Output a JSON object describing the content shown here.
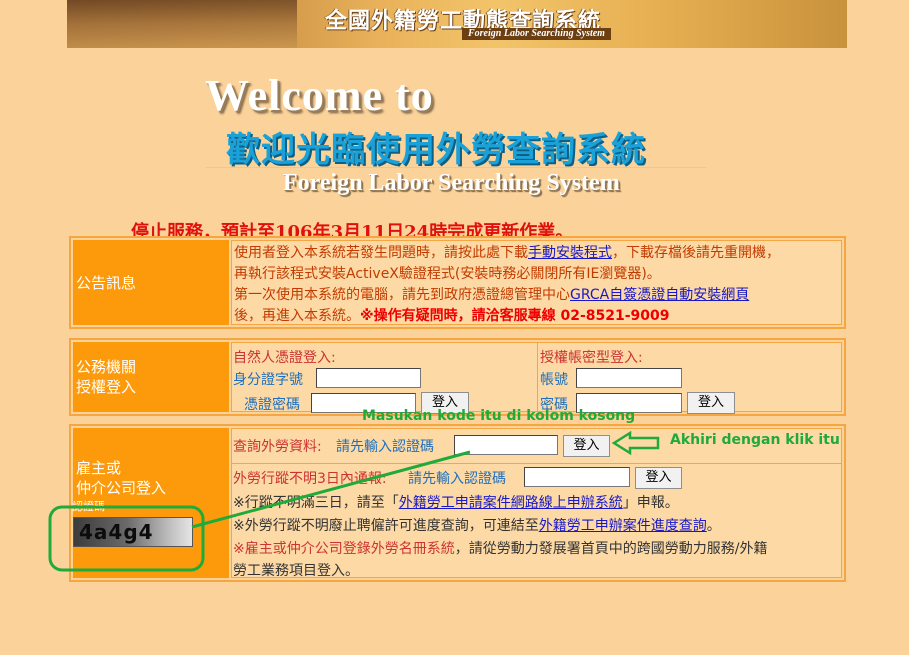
{
  "banner": {
    "title": "全國外籍勞工動態查詢系統",
    "subtitle": "Foreign Labor Searching System"
  },
  "welcome": {
    "en": "Welcome to",
    "zh": "歡迎光臨使用外勞查詢系統",
    "sub": "Foreign Labor Searching System"
  },
  "marquee": "停止服務，預計至106年3月11日24時完成更新作業。",
  "announcement": {
    "head": "公告訊息",
    "line1_pre": "使用者登入本系統若發生問題時，請按此處下載",
    "line1_link": "手動安裝程式",
    "line1_post": "，下載存檔後請先重開機，",
    "line2": "再執行該程式安裝ActiveX驗證程式(安裝時務必關閉所有IE瀏覽器)。",
    "line3_pre": "第一次使用本系統的電腦，請先到政府憑證總管理中心",
    "line3_link": "GRCA自簽憑證自動安裝網頁",
    "line4_pre": "後，再進入本系統。",
    "line4_bold": "※操作有疑問時，請洽客服專線 02-8521-9009"
  },
  "gov_login": {
    "head_line1": "公務機關",
    "head_line2": "授權登入",
    "natural_title": "自然人憑證登入:",
    "id_label": "身分證字號",
    "pin_label": "憑證密碼",
    "login_button": "登入",
    "account_title": "授權帳密型登入:",
    "account_label": "帳號",
    "password_label": "密碼",
    "login_button2": "登入"
  },
  "employer": {
    "head_line1": "雇主或",
    "head_line2": "仲介公司登入",
    "captcha_label": "認證碼",
    "captcha_value": "4a4g4",
    "query_label": "查詢外勞資料:",
    "query_prompt": "請先輸入認證碼",
    "query_button": "登入",
    "missing_label": "外勞行蹤不明3日內通報:",
    "missing_prompt": "請先輸入認證碼",
    "missing_button": "登入",
    "note1_pre": "※行蹤不明滿三日，請至「",
    "note1_link": "外籍勞工申請案件網路線上申辦系統",
    "note1_post": "」申報。",
    "note2_pre": "※外勞行蹤不明廢止聘僱許可進度查詢，可連結至",
    "note2_link": "外籍勞工申辦案件進度查詢",
    "note2_post": "。",
    "note3_red": "※雇主或仲介公司登錄外勞名冊系統",
    "note3_post": "，請從勞動力發展署首頁中的跨國勞動力服務/外籍",
    "note4": "勞工業務項目登入。"
  },
  "overlay": {
    "hint_input": "Masukan kode itu di kolom kosong",
    "hint_click": "Akhiri dengan klik itu"
  }
}
